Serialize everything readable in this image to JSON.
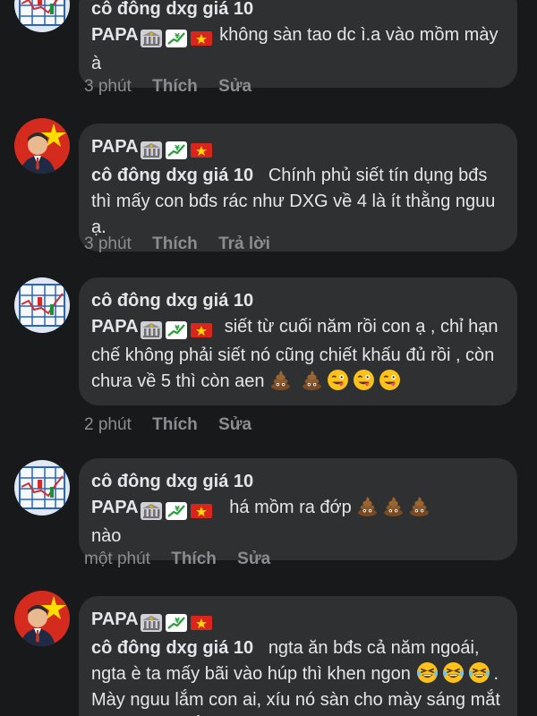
{
  "icons": {
    "stock_chart_avatar": "stock-chart-avatar",
    "vietnam_flag_avatar": "flag-portrait-avatar",
    "bank": "bank-icon",
    "yen_chart": "yen-chart-icon",
    "flag": "vietnam-flag-icon",
    "poop": "poop-emoji",
    "winking_tongue": "winking-tongue-emoji",
    "rofl": "rolling-laughing-emoji"
  },
  "colors": {
    "background": "#18191a",
    "bubble": "#2f3031",
    "text": "#e4e6eb",
    "meta": "#8a8d91"
  },
  "comments": [
    {
      "name_line": "cô đông dxg giá 10",
      "author": "PAPA",
      "text": "không sàn tao dc ì.a  vào mồm mày à",
      "time": "3 phút",
      "like": "Thích",
      "action2": "Sửa"
    },
    {
      "author": "PAPA",
      "mention": "cô đông dxg giá 10",
      "text": "Chính phủ siết tín dụng bđs thì mấy con bđs rác như DXG về 4 là ít thằng nguu ạ.",
      "time": "3 phút",
      "like": "Thích",
      "action2": "Trả lời"
    },
    {
      "name_line": "cô đông dxg giá 10",
      "author": "PAPA",
      "text": "siết từ cuối năm rồi con ạ , chỉ hạn chế không phải siết nó cũng chiết khấu đủ rồi , còn chưa về 5 thì còn aen",
      "time": "2 phút",
      "like": "Thích",
      "action2": "Sửa"
    },
    {
      "name_line": "cô đông dxg giá 10",
      "author": "PAPA",
      "text": "há mồm ra đớp",
      "text_end": "nào",
      "time": "một phút",
      "like": "Thích",
      "action2": "Sửa"
    },
    {
      "author": "PAPA",
      "mention": "cô đông dxg giá 10",
      "text": "ngta ăn bđs cả năm ngoái, ngta è ta mấy bãi vào húp thì khen ngon",
      "text_end": ". Mày nguu lắm con ai, xíu nó sàn cho mày sáng mắt lên. Bố cái thằng"
    }
  ]
}
